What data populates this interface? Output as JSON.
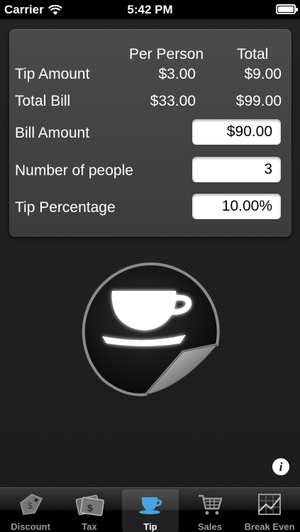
{
  "status": {
    "carrier": "Carrier",
    "time": "5:42 PM"
  },
  "panel": {
    "headers": {
      "per_person": "Per Person",
      "total": "Total"
    },
    "tip_amount": {
      "label": "Tip Amount",
      "per_person": "$3.00",
      "total": "$9.00"
    },
    "total_bill": {
      "label": "Total Bill",
      "per_person": "$33.00",
      "total": "$99.00"
    },
    "bill_amount": {
      "label": "Bill Amount",
      "value": "$90.00"
    },
    "number_of_people": {
      "label": "Number of people",
      "value": "3"
    },
    "tip_percentage": {
      "label": "Tip Percentage",
      "value": "10.00%"
    }
  },
  "info_glyph": "i",
  "tabs": [
    {
      "label": "Discount",
      "icon": "price-tag-icon"
    },
    {
      "label": "Tax",
      "icon": "money-icon"
    },
    {
      "label": "Tip",
      "icon": "coffee-cup-icon",
      "active": true
    },
    {
      "label": "Sales",
      "icon": "shopping-cart-icon"
    },
    {
      "label": "Break Even",
      "icon": "line-chart-icon"
    }
  ],
  "colors": {
    "accent_active_tab_icon": "#4aa3e0",
    "panel": "#444444",
    "background": "#1b1b1b"
  }
}
